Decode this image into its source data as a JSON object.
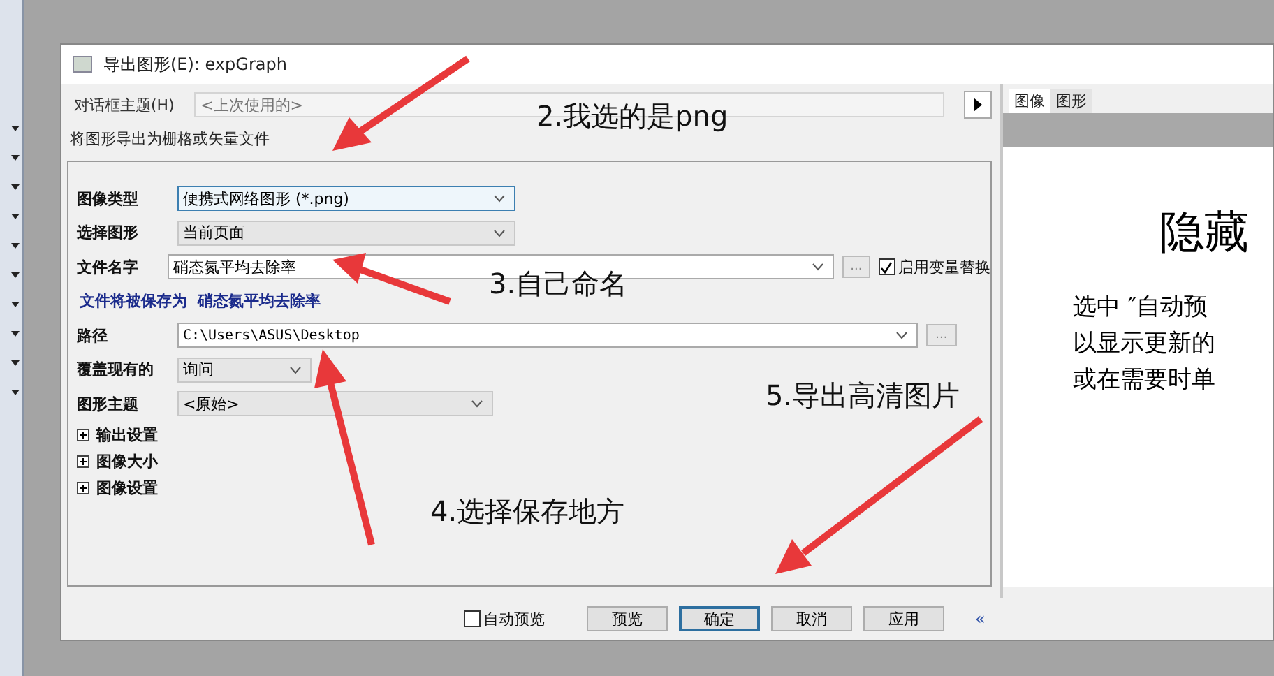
{
  "window": {
    "title": "导出图形(E): expGraph"
  },
  "dialog_theme": {
    "label": "对话框主题(H)",
    "placeholder": "<上次使用的>"
  },
  "description": "将图形导出为栅格或矢量文件",
  "fields": [
    {
      "kind": "select",
      "label": "图像类型",
      "value": "便携式网络图形 (*.png)",
      "focused": true
    },
    {
      "kind": "select",
      "label": "选择图形",
      "value": "当前页面",
      "focused": false
    },
    {
      "kind": "combo",
      "label": "文件名字",
      "value": "硝态氮平均去除率",
      "browse": "...",
      "checkbox": {
        "label": "启用变量替换",
        "checked": true
      }
    },
    {
      "kind": "note",
      "label": "文件将被保存为",
      "value": "硝态氮平均去除率"
    },
    {
      "kind": "combo",
      "label": "路径",
      "value": "C:\\Users\\ASUS\\Desktop",
      "browse": "..."
    },
    {
      "kind": "small",
      "label": "覆盖现有的",
      "value": "询问"
    },
    {
      "kind": "medium",
      "label": "图形主题",
      "value": "<原始>"
    }
  ],
  "sections": [
    {
      "label": "输出设置",
      "expanded": false
    },
    {
      "label": "图像大小",
      "expanded": false
    },
    {
      "label": "图像设置",
      "expanded": false
    }
  ],
  "preview": {
    "tabs": [
      {
        "label": "图像",
        "selected": true
      },
      {
        "label": "图形",
        "selected": false
      }
    ],
    "heading": "隐藏",
    "lines": [
      "选中 ″自动预",
      "以显示更新的",
      "或在需要时单"
    ]
  },
  "auto_preview": {
    "label": "自动预览",
    "checked": false
  },
  "buttons": [
    {
      "label": "预览",
      "default": false
    },
    {
      "label": "确定",
      "default": true
    },
    {
      "label": "取消",
      "default": false
    },
    {
      "label": "应用",
      "default": false
    }
  ],
  "collapse": "«",
  "annotations": [
    "2.我选的是png",
    "3.自己命名",
    "5.导出高清图片",
    "4.选择保存地方"
  ]
}
